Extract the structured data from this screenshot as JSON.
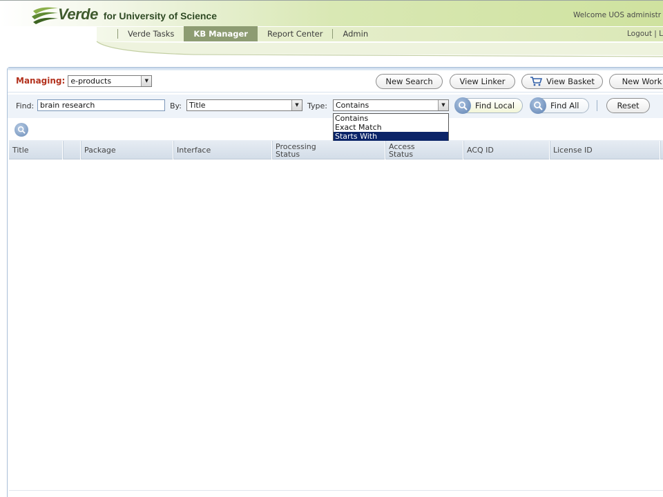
{
  "header": {
    "logo_word": "Verde",
    "logo_sub": "for University of Science",
    "welcome": "Welcome UOS administr",
    "logout": "Logout | L",
    "nav": [
      {
        "label": "Verde Tasks",
        "active": false
      },
      {
        "label": "KB Manager",
        "active": true
      },
      {
        "label": "Report Center",
        "active": false
      },
      {
        "label": "Admin",
        "active": false
      }
    ]
  },
  "toolbar": {
    "managing_label": "Managing:",
    "managing_value": "e-products",
    "new_search": "New Search",
    "view_linker": "View Linker",
    "view_basket": "View Basket",
    "new_work": "New Work"
  },
  "search": {
    "find_label": "Find:",
    "find_value": "brain research",
    "by_label": "By:",
    "by_value": "Title",
    "type_label": "Type:",
    "type_value": "Contains",
    "type_options": [
      "Contains",
      "Exact Match",
      "Starts With"
    ],
    "type_highlighted": "Starts With",
    "find_local": "Find Local",
    "find_all": "Find All",
    "reset": "Reset"
  },
  "grid": {
    "columns": [
      {
        "label": "Title"
      },
      {
        "label": ""
      },
      {
        "label": "Package"
      },
      {
        "label": "Interface"
      },
      {
        "label": "Processing Status",
        "line1": "Processing",
        "line2": "Status"
      },
      {
        "label": "Access Status",
        "line1": "Access",
        "line2": "Status"
      },
      {
        "label": "ACQ ID"
      },
      {
        "label": "License ID"
      }
    ]
  },
  "colors": {
    "header_green": "#cfe29f",
    "active_tab": "#8d9c72",
    "managing_red": "#b3321e",
    "dropdown_highlight": "#0b2468",
    "panel_border": "#a9bfd8"
  },
  "icons": [
    "verde-logo-icon",
    "cart-icon",
    "magnifier-icon"
  ]
}
